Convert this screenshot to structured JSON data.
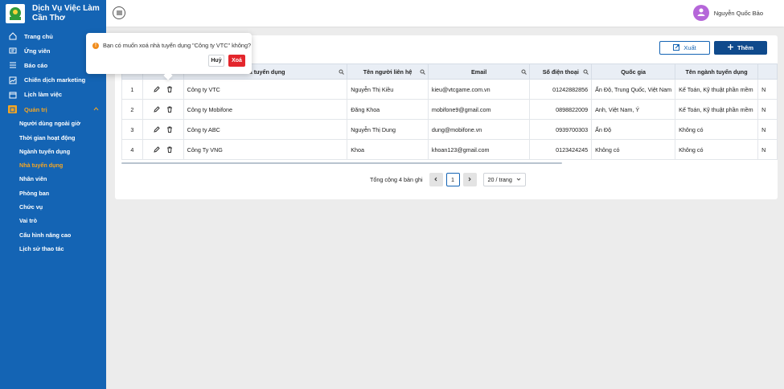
{
  "brand": {
    "line1": "Dịch Vụ Việc Làm",
    "line2": "Cần Thơ"
  },
  "sidebar": {
    "items": [
      {
        "label": "Trang chủ",
        "icon": "home-icon"
      },
      {
        "label": "Ứng viên",
        "icon": "id-card-icon"
      },
      {
        "label": "Báo cáo",
        "icon": "list-icon"
      },
      {
        "label": "Chiến dịch marketing",
        "icon": "chart-icon"
      },
      {
        "label": "Lịch làm việc",
        "icon": "calendar-icon"
      },
      {
        "label": "Quản trị",
        "icon": "admin-icon"
      }
    ],
    "sub_items": [
      {
        "label": "Người dùng ngoài giờ"
      },
      {
        "label": "Thời gian hoạt động"
      },
      {
        "label": "Ngành tuyển dụng"
      },
      {
        "label": "Nhà tuyển dụng",
        "active": true
      },
      {
        "label": "Nhân viên"
      },
      {
        "label": "Phòng ban"
      },
      {
        "label": "Chức vụ"
      },
      {
        "label": "Vai trò"
      },
      {
        "label": "Cấu hình nâng cao"
      },
      {
        "label": "Lịch sử thao tác"
      }
    ]
  },
  "header": {
    "user_name": "Nguyễn Quốc Bảo"
  },
  "toolbar": {
    "export_label": "Xuất",
    "add_label": "Thêm"
  },
  "table": {
    "columns": [
      "",
      "",
      "hà tuyển dụng",
      "Tên người liên hệ",
      "Email",
      "Số điện thoại",
      "Quốc gia",
      "Tên ngành tuyển dụng",
      ""
    ],
    "rows": [
      {
        "index": "1",
        "company": "Công ty VTC",
        "contact": "Nguyễn Thị Kiều",
        "email": "kieu@vtcgame.com.vn",
        "phone": "01242882856",
        "country": "Ấn Độ, Trung Quốc, Việt Nam",
        "industry": "Kế Toán, Kỹ thuật phần mềm",
        "extra": "N"
      },
      {
        "index": "2",
        "company": "Công ty Mobifone",
        "contact": "Đăng Khoa",
        "email": "mobifone9@gmail.com",
        "phone": "0898822009",
        "country": "Anh, Việt Nam, Ý",
        "industry": "Kế Toán, Kỹ thuật phần mềm",
        "extra": "N"
      },
      {
        "index": "3",
        "company": "Công ty ABC",
        "contact": "Nguyễn Thị Dung",
        "email": "dung@mobifone.vn",
        "phone": "0939700303",
        "country": "Ấn Độ",
        "industry": "Không có",
        "extra": "N"
      },
      {
        "index": "4",
        "company": "Công Ty VNG",
        "contact": "Khoa",
        "email": "khoan123@gmail.com",
        "phone": "0123424245",
        "country": "Không có",
        "industry": "Không có",
        "extra": "N"
      }
    ]
  },
  "pagination": {
    "total": "Tổng cộng 4 bản ghi",
    "current_page": "1",
    "page_size": "20 / trang"
  },
  "popconfirm": {
    "message": "Bạn có muốn xoá nhà tuyển dụng \"Công ty VTC\" không?",
    "cancel": "Huỷ",
    "ok": "Xoá"
  },
  "colors": {
    "sidebar": "#1464b4",
    "primary": "#0f4a8c",
    "active": "#f5a623",
    "danger": "#e3262c",
    "avatar": "#b566d9"
  }
}
